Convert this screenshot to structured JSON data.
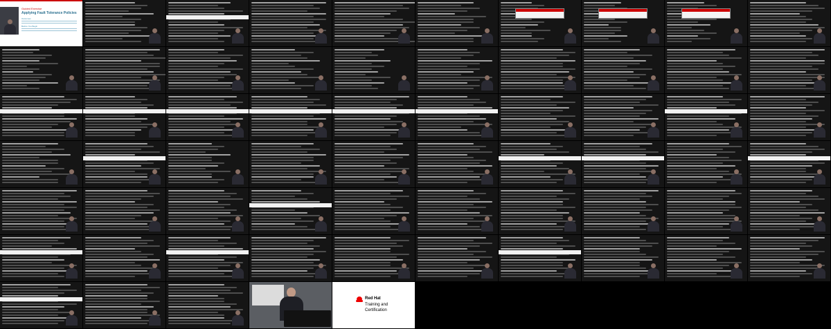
{
  "contact_sheet": {
    "columns": 10,
    "rows": 7,
    "intro_slide": {
      "kicker": "Guided Exercise",
      "title": "Applying Fault Tolerance Policies",
      "sections": [
        "Outcomes",
        "Before You Begin"
      ]
    },
    "brand_slide": {
      "logo_name": "Red Hat",
      "line1": "Training and",
      "line2": "Certification"
    },
    "tiles": [
      {
        "kind": "slide"
      },
      {
        "kind": "terminal",
        "lines": [
          8,
          10,
          9,
          7,
          11,
          6,
          9,
          8
        ],
        "bar": false
      },
      {
        "kind": "terminal",
        "lines": [
          10,
          8,
          9,
          12,
          9,
          8
        ],
        "bar": true
      },
      {
        "kind": "terminal",
        "lines": [
          12,
          10,
          11,
          9,
          12,
          10
        ],
        "bar": false
      },
      {
        "kind": "terminal",
        "lines": [
          13,
          11,
          12,
          10,
          9,
          8,
          11
        ],
        "bar": false
      },
      {
        "kind": "terminal",
        "lines": [
          9,
          7,
          10,
          8,
          6,
          11,
          9
        ],
        "bar": false
      },
      {
        "kind": "terminal",
        "lines": [
          5,
          7,
          6,
          4,
          8,
          5
        ],
        "bar": false,
        "dialog": true
      },
      {
        "kind": "terminal",
        "lines": [
          6,
          5,
          7,
          4,
          6
        ],
        "bar": false,
        "dialog": true
      },
      {
        "kind": "terminal",
        "lines": [
          6,
          8,
          5,
          7,
          4
        ],
        "bar": false,
        "dialog": true
      },
      {
        "kind": "terminal",
        "lines": [
          9,
          11,
          12,
          10,
          8,
          9,
          10
        ],
        "bar": false
      },
      {
        "kind": "terminal",
        "lines": [
          6,
          5,
          8,
          7,
          6,
          9,
          4
        ],
        "bar": false
      },
      {
        "kind": "terminal",
        "lines": [
          12,
          10,
          11,
          13,
          9,
          12
        ],
        "bar": false
      },
      {
        "kind": "terminal",
        "lines": [
          9,
          8,
          12,
          10,
          11
        ],
        "bar": false
      },
      {
        "kind": "terminal",
        "lines": [
          7,
          10,
          8,
          9,
          11,
          6
        ],
        "bar": false
      },
      {
        "kind": "terminal",
        "lines": [
          8,
          6,
          7,
          5,
          9,
          6
        ],
        "bar": false
      },
      {
        "kind": "terminal",
        "lines": [
          8,
          10,
          9,
          7,
          12,
          10
        ],
        "bar": false
      },
      {
        "kind": "terminal",
        "lines": [
          10,
          12,
          11,
          9,
          12,
          10
        ],
        "bar": false
      },
      {
        "kind": "terminal",
        "lines": [
          9,
          7,
          11,
          8,
          10
        ],
        "bar": false
      },
      {
        "kind": "terminal",
        "lines": [
          11,
          9,
          10,
          12,
          8,
          9
        ],
        "bar": false
      },
      {
        "kind": "terminal",
        "lines": [
          12,
          10,
          11,
          9,
          12
        ],
        "bar": false
      },
      {
        "kind": "terminal",
        "lines": [
          10,
          12,
          11,
          9,
          8,
          12,
          10
        ],
        "bar": true
      },
      {
        "kind": "terminal",
        "lines": [
          8,
          10,
          9,
          11,
          10,
          9,
          8
        ],
        "bar": true
      },
      {
        "kind": "terminal",
        "lines": [
          11,
          9,
          12,
          10,
          11,
          9
        ],
        "bar": true
      },
      {
        "kind": "terminal",
        "lines": [
          9,
          11,
          10,
          12,
          9
        ],
        "bar": true
      },
      {
        "kind": "terminal",
        "lines": [
          12,
          10,
          9,
          11,
          10,
          8
        ],
        "bar": true
      },
      {
        "kind": "terminal",
        "lines": [
          8,
          10,
          11,
          9,
          12,
          7
        ],
        "bar": true
      },
      {
        "kind": "terminal",
        "lines": [
          10,
          8,
          12,
          9,
          11
        ],
        "bar": false
      },
      {
        "kind": "terminal",
        "lines": [
          11,
          10,
          9,
          12,
          8
        ],
        "bar": false
      },
      {
        "kind": "terminal",
        "lines": [
          9,
          12,
          10,
          11,
          8
        ],
        "bar": true
      },
      {
        "kind": "terminal",
        "lines": [
          12,
          9,
          11,
          10,
          9
        ],
        "bar": false
      },
      {
        "kind": "terminal",
        "lines": [
          9,
          7,
          10,
          8,
          11,
          6,
          9
        ],
        "bar": false
      },
      {
        "kind": "terminal",
        "lines": [
          10,
          11,
          9,
          12,
          8,
          10
        ],
        "bar": true
      },
      {
        "kind": "terminal",
        "lines": [
          7,
          9,
          8,
          6,
          10,
          7
        ],
        "bar": false
      },
      {
        "kind": "terminal",
        "lines": [
          10,
          8,
          11,
          9,
          12,
          10
        ],
        "bar": false
      },
      {
        "kind": "terminal",
        "lines": [
          11,
          9,
          10,
          8,
          12
        ],
        "bar": false
      },
      {
        "kind": "terminal",
        "lines": [
          9,
          11,
          10,
          12,
          8
        ],
        "bar": false
      },
      {
        "kind": "terminal",
        "lines": [
          8,
          10,
          9,
          11,
          7,
          12
        ],
        "bar": true
      },
      {
        "kind": "terminal",
        "lines": [
          11,
          9,
          10,
          12,
          10
        ],
        "bar": true
      },
      {
        "kind": "terminal",
        "lines": [
          10,
          12,
          9,
          11,
          8
        ],
        "bar": false
      },
      {
        "kind": "terminal",
        "lines": [
          9,
          11,
          12,
          10,
          9
        ],
        "bar": true
      },
      {
        "kind": "terminal",
        "lines": [
          12,
          10,
          11,
          9,
          12,
          10
        ],
        "bar": false
      },
      {
        "kind": "terminal",
        "lines": [
          10,
          12,
          11,
          9,
          8,
          11
        ],
        "bar": false
      },
      {
        "kind": "terminal",
        "lines": [
          9,
          11,
          10,
          12,
          8,
          10
        ],
        "bar": false
      },
      {
        "kind": "terminal",
        "lines": [
          8,
          10,
          7,
          9,
          11
        ],
        "bar": true
      },
      {
        "kind": "terminal",
        "lines": [
          11,
          9,
          12,
          10,
          8,
          9
        ],
        "bar": false
      },
      {
        "kind": "terminal",
        "lines": [
          9,
          11,
          8,
          10,
          12
        ],
        "bar": false
      },
      {
        "kind": "terminal",
        "lines": [
          10,
          12,
          9,
          11,
          10
        ],
        "bar": false
      },
      {
        "kind": "terminal",
        "lines": [
          12,
          10,
          11,
          9,
          10
        ],
        "bar": false
      },
      {
        "kind": "terminal",
        "lines": [
          11,
          12,
          10,
          9,
          11
        ],
        "bar": false
      },
      {
        "kind": "terminal",
        "lines": [
          10,
          9,
          11,
          12,
          8
        ],
        "bar": false
      },
      {
        "kind": "terminal",
        "lines": [
          11,
          9,
          10,
          8,
          12,
          10
        ],
        "bar": true
      },
      {
        "kind": "terminal",
        "lines": [
          9,
          11,
          10,
          12,
          8
        ],
        "bar": false
      },
      {
        "kind": "terminal",
        "lines": [
          10,
          8,
          11,
          9,
          12
        ],
        "bar": true
      },
      {
        "kind": "terminal",
        "lines": [
          12,
          10,
          9,
          11,
          10
        ],
        "bar": false
      },
      {
        "kind": "terminal",
        "lines": [
          9,
          12,
          10,
          11,
          9
        ],
        "bar": false
      },
      {
        "kind": "terminal",
        "lines": [
          11,
          9,
          12,
          10,
          8
        ],
        "bar": false
      },
      {
        "kind": "terminal",
        "lines": [
          10,
          11,
          9,
          12,
          10
        ],
        "bar": true
      },
      {
        "kind": "terminal",
        "lines": [
          9,
          10,
          12,
          11,
          9
        ],
        "bar": false
      },
      {
        "kind": "terminal",
        "lines": [
          10,
          9,
          11,
          8,
          12
        ],
        "bar": false
      },
      {
        "kind": "terminal",
        "lines": [
          12,
          11,
          9,
          10,
          8
        ],
        "bar": false
      },
      {
        "kind": "terminal",
        "lines": [
          11,
          9,
          12,
          10,
          9
        ],
        "bar": true
      },
      {
        "kind": "terminal",
        "lines": [
          10,
          12,
          9,
          11,
          10
        ],
        "bar": false
      },
      {
        "kind": "terminal",
        "lines": [
          9,
          11,
          10,
          12,
          8,
          9
        ],
        "bar": false
      },
      {
        "kind": "studio"
      },
      {
        "kind": "brand"
      }
    ]
  }
}
